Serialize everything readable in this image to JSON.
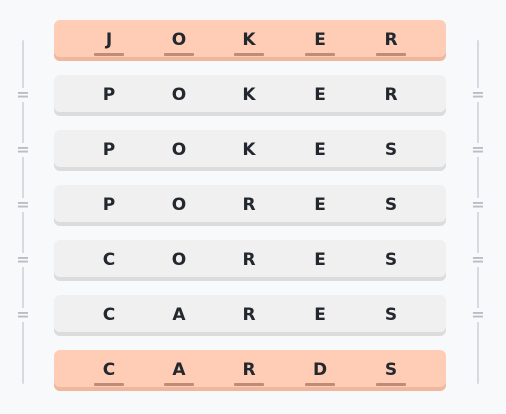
{
  "puzzle": {
    "ladder": [
      {
        "word": [
          "J",
          "O",
          "K",
          "E",
          "R"
        ],
        "kind": "start"
      },
      {
        "word": [
          "P",
          "O",
          "K",
          "E",
          "R"
        ],
        "kind": "step"
      },
      {
        "word": [
          "P",
          "O",
          "K",
          "E",
          "S"
        ],
        "kind": "step"
      },
      {
        "word": [
          "P",
          "O",
          "R",
          "E",
          "S"
        ],
        "kind": "step"
      },
      {
        "word": [
          "C",
          "O",
          "R",
          "E",
          "S"
        ],
        "kind": "step"
      },
      {
        "word": [
          "C",
          "A",
          "R",
          "E",
          "S"
        ],
        "kind": "step"
      },
      {
        "word": [
          "C",
          "A",
          "R",
          "D",
          "S"
        ],
        "kind": "end"
      }
    ],
    "equals_symbol": "="
  }
}
